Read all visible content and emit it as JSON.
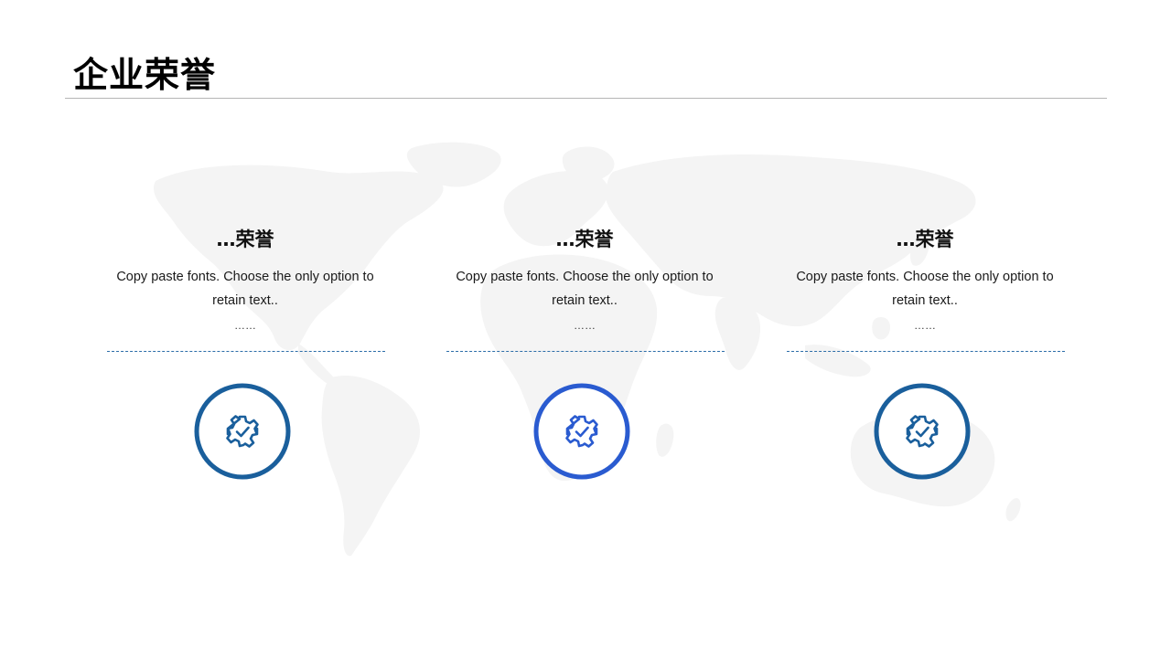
{
  "title": "企业荣誉",
  "cards": [
    {
      "title": "…荣誉",
      "description": "Copy paste fonts. Choose the only option to retain text..",
      "ellipsis": "……",
      "icon": "gear-check-icon",
      "ring_color": "#1a5f9c"
    },
    {
      "title": "…荣誉",
      "description": "Copy paste fonts. Choose the only option to retain text..",
      "ellipsis": "……",
      "icon": "gear-check-icon",
      "ring_color": "#2a5bd0"
    },
    {
      "title": "…荣誉",
      "description": "Copy paste fonts. Choose the only option to retain text..",
      "ellipsis": "……",
      "icon": "gear-check-icon",
      "ring_color": "#1a5f9c"
    }
  ],
  "colors": {
    "accent_dark": "#1a5f9c",
    "accent_bright": "#2a5bd0",
    "divider": "#2c6da8",
    "map": "#f4f4f4"
  }
}
